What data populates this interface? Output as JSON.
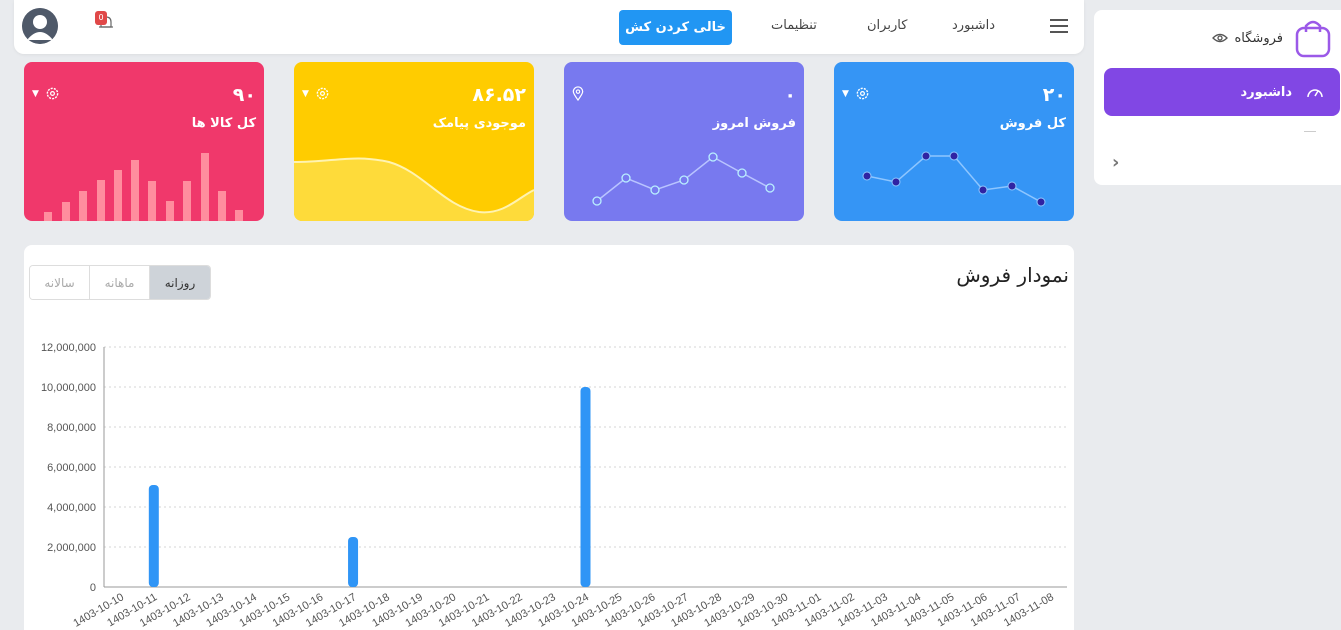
{
  "sidebar": {
    "brand_label": "فروشگاه",
    "active_item_label": "داشبورد"
  },
  "navbar": {
    "notification_count": "0",
    "clear_cart_label": "خالی کردن کش",
    "links": [
      "تنظیمات",
      "کاربران",
      "داشبورد"
    ]
  },
  "cards": [
    {
      "value": "۲۰",
      "label": "کل فروش",
      "color": "#3595f5",
      "spark": "dots-line"
    },
    {
      "value": "۰",
      "label": "فروش امروز",
      "color": "#7879ef",
      "spark": "circles-line"
    },
    {
      "value": "۸۶.۵۲",
      "label": "موجودی پیامک",
      "color": "#ffcc00",
      "spark": "area"
    },
    {
      "value": "۹۰",
      "label": "کل کالا ها",
      "color": "#f0386b",
      "spark": "bars"
    }
  ],
  "panel": {
    "title": "نمودار فروش",
    "periods": [
      "سالانه",
      "ماهانه",
      "روزانه"
    ],
    "active_period": "روزانه"
  },
  "chart_data": {
    "type": "bar",
    "color": "#2f95f6",
    "ylim": [
      0,
      12000000
    ],
    "yticks": [
      "0",
      "2,000,000",
      "4,000,000",
      "6,000,000",
      "8,000,000",
      "10,000,000",
      "12,000,000"
    ],
    "categories": [
      "1403-10-10",
      "1403-10-11",
      "1403-10-12",
      "1403-10-13",
      "1403-10-14",
      "1403-10-15",
      "1403-10-16",
      "1403-10-17",
      "1403-10-18",
      "1403-10-19",
      "1403-10-20",
      "1403-10-21",
      "1403-10-22",
      "1403-10-23",
      "1403-10-24",
      "1403-10-25",
      "1403-10-26",
      "1403-10-27",
      "1403-10-28",
      "1403-10-29",
      "1403-10-30",
      "1403-11-01",
      "1403-11-02",
      "1403-11-03",
      "1403-11-04",
      "1403-11-05",
      "1403-11-06",
      "1403-11-07",
      "1403-11-08"
    ],
    "values": [
      0,
      5100000,
      0,
      0,
      0,
      0,
      0,
      2500000,
      0,
      0,
      0,
      0,
      0,
      0,
      10000000,
      0,
      0,
      0,
      0,
      0,
      0,
      0,
      0,
      0,
      0,
      0,
      0,
      0,
      0
    ]
  }
}
